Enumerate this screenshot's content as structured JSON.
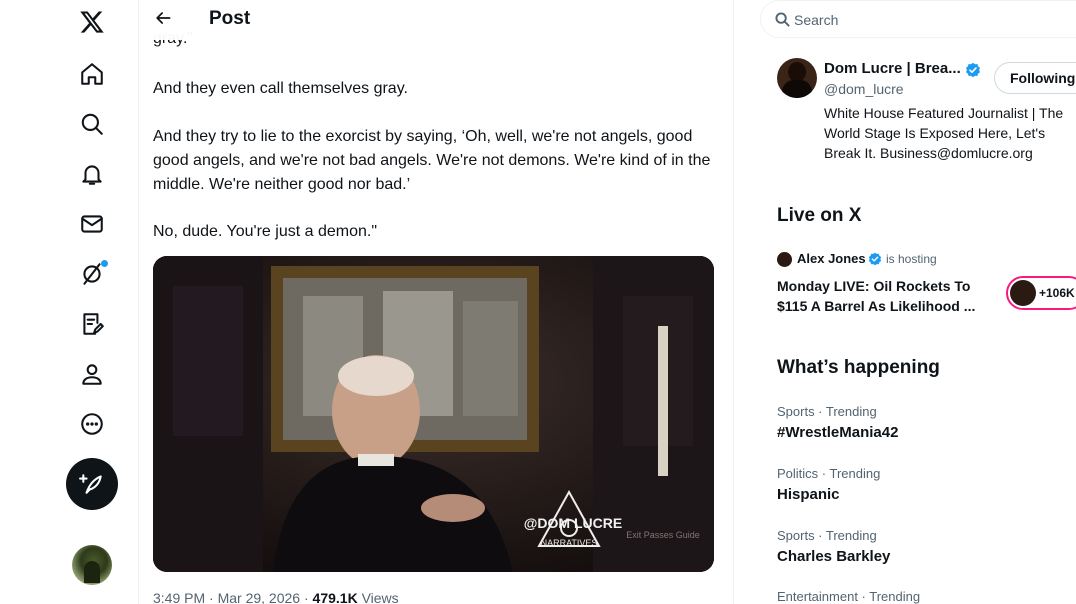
{
  "nav": {
    "items": [
      {
        "name": "x-logo-icon"
      },
      {
        "name": "home-icon"
      },
      {
        "name": "search-icon"
      },
      {
        "name": "notifications-icon"
      },
      {
        "name": "messages-icon"
      },
      {
        "name": "grok-icon"
      },
      {
        "name": "lists-icon"
      },
      {
        "name": "profile-icon"
      },
      {
        "name": "more-icon"
      }
    ],
    "compose_icon": "feather-plus-icon"
  },
  "header": {
    "title": "Post"
  },
  "post": {
    "cut_text": "gray.\"",
    "paragraphs": [
      "And they even call themselves gray.",
      "And they try to lie to the exorcist by saying, ‘Oh, well, we're not angels, good good angels, and we're not bad angels. We're not demons. We're kind of in the middle. We're neither good nor bad.’",
      "No, dude. You're just a demon.\""
    ],
    "media_watermark": "@DOM LUCRE",
    "media_watermark_sub": "NARRATIVES",
    "media_corner_text": "Exit Passes Guide",
    "time": "3:49 PM · Mar 29, 2026 · ",
    "views_count": "479.1K",
    "views_label": " Views"
  },
  "search": {
    "placeholder": "Search"
  },
  "who_card": {
    "name": "Dom Lucre | Brea...",
    "handle": "@dom_lucre",
    "follow_label": "Following",
    "bio": "White House Featured Journalist | The World Stage Is Exposed Here, Let's Break It. Business@domlucre.org",
    "verified_color": "#1d9bf0"
  },
  "live": {
    "heading": "Live on X",
    "host": "Alex Jones",
    "hosting_label": "is hosting",
    "title": "Monday LIVE: Oil Rockets To $115 A Barrel As Likelihood ...",
    "listeners": "+106K",
    "accent_color": "#f91880"
  },
  "happening": {
    "heading": "What’s happening",
    "trends": [
      {
        "meta": "Sports · Trending",
        "name": "#WrestleMania42"
      },
      {
        "meta": "Politics · Trending",
        "name": "Hispanic"
      },
      {
        "meta": "Sports · Trending",
        "name": "Charles Barkley"
      },
      {
        "meta": "Entertainment · Trending",
        "name": ""
      }
    ]
  }
}
